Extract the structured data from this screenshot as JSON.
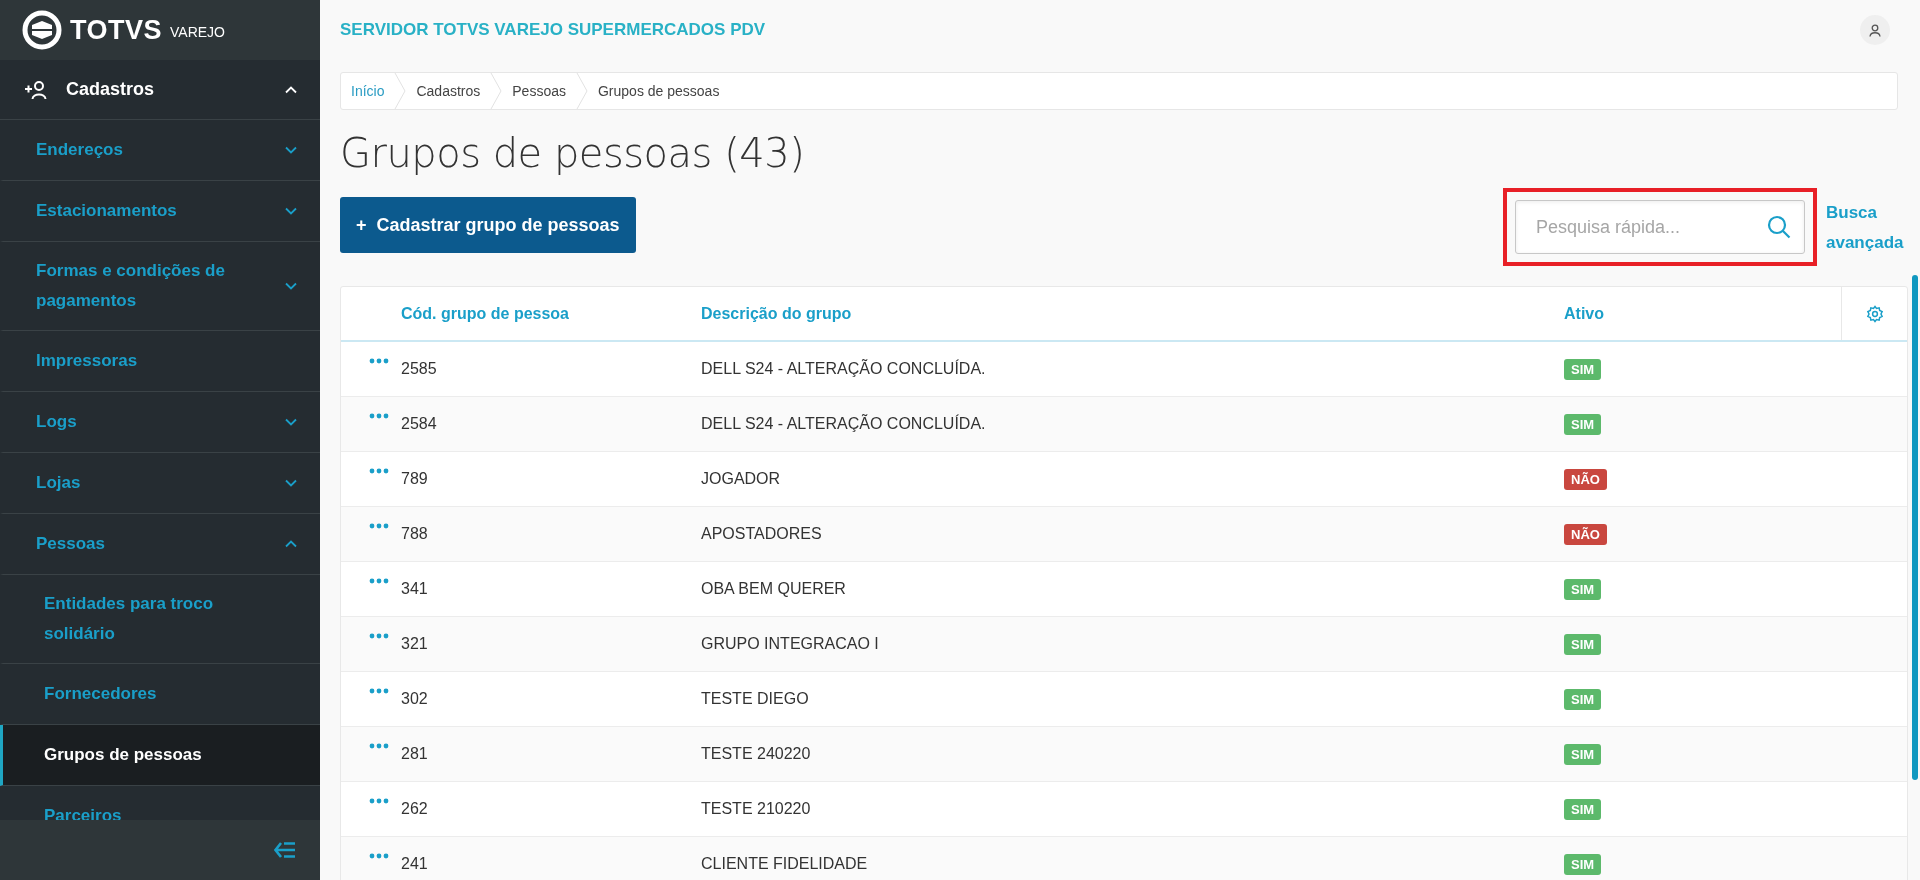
{
  "logo": {
    "brand": "TOTVS",
    "product": "VAREJO"
  },
  "sidebar": {
    "section": {
      "label": "Cadastros",
      "expanded": true,
      "items": [
        {
          "label": "Endereços",
          "expanded": false
        },
        {
          "label": "Estacionamentos",
          "expanded": false
        },
        {
          "label": "Formas e condições de pagamentos",
          "expanded": false
        },
        {
          "label": "Impressoras"
        },
        {
          "label": "Logs",
          "expanded": false
        },
        {
          "label": "Lojas",
          "expanded": false
        },
        {
          "label": "Pessoas",
          "expanded": true,
          "children": [
            {
              "label": "Entidades para troco solidário",
              "selected": false
            },
            {
              "label": "Fornecedores",
              "selected": false
            },
            {
              "label": "Grupos de pessoas",
              "selected": true
            },
            {
              "label": "Parceiros",
              "selected": false
            }
          ]
        }
      ]
    }
  },
  "header": {
    "title": "SERVIDOR TOTVS VAREJO SUPERMERCADOS PDV"
  },
  "breadcrumb": [
    {
      "label": "Início",
      "link": true
    },
    {
      "label": "Cadastros",
      "link": false
    },
    {
      "label": "Pessoas",
      "link": false
    },
    {
      "label": "Grupos de pessoas",
      "link": false
    }
  ],
  "page_title": "Grupos de pessoas (43)",
  "add_button": "+  Cadastrar grupo de pessoas",
  "search": {
    "placeholder": "Pesquisa rápida...",
    "highlighted": true
  },
  "advanced_search": "Busca avançada",
  "table": {
    "columns": [
      "Cód. grupo de pessoa",
      "Descrição do grupo",
      "Ativo"
    ],
    "rows": [
      {
        "code": "2585",
        "description": "DELL S24 - ALTERAÇÃO CONCLUÍDA.",
        "active": true,
        "status": "SIM"
      },
      {
        "code": "2584",
        "description": "DELL S24 - ALTERAÇÃO CONCLUÍDA.",
        "active": true,
        "status": "SIM"
      },
      {
        "code": "789",
        "description": "JOGADOR",
        "active": false,
        "status": "NÃO"
      },
      {
        "code": "788",
        "description": "APOSTADORES",
        "active": false,
        "status": "NÃO"
      },
      {
        "code": "341",
        "description": "OBA BEM QUERER",
        "active": true,
        "status": "SIM"
      },
      {
        "code": "321",
        "description": "GRUPO INTEGRACAO I",
        "active": true,
        "status": "SIM"
      },
      {
        "code": "302",
        "description": "TESTE DIEGO",
        "active": true,
        "status": "SIM"
      },
      {
        "code": "281",
        "description": "TESTE 240220",
        "active": true,
        "status": "SIM"
      },
      {
        "code": "262",
        "description": "TESTE 210220",
        "active": true,
        "status": "SIM"
      },
      {
        "code": "241",
        "description": "CLIENTE FIDELIDADE",
        "active": true,
        "status": "SIM"
      }
    ]
  }
}
